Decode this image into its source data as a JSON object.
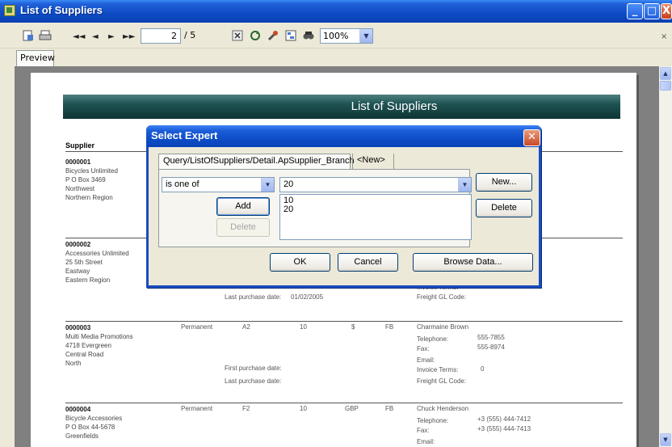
{
  "window": {
    "title": "List of Suppliers",
    "controls": {
      "minimize": "_",
      "maximize": "□",
      "close": "X"
    }
  },
  "toolbar": {
    "nav_first": "◄◄",
    "nav_prev": "◄",
    "nav_next": "►",
    "nav_last": "►►",
    "page_current": "2",
    "page_total": "/ 5",
    "zoom": "100%",
    "close_glyph": "×",
    "icons": [
      "export-icon",
      "print-icon",
      "stop-icon",
      "refresh-icon",
      "tools-icon",
      "group-tree-icon",
      "search-icon"
    ]
  },
  "tabs": {
    "preview": "Preview"
  },
  "report": {
    "banner_title": "List of Suppliers",
    "column_supplier": "Supplier",
    "records": [
      {
        "id": "0000001",
        "lines": [
          "Bicycles Unlimited",
          "P O Box 3469",
          "Northwest",
          "Northern Region"
        ]
      },
      {
        "id": "0000002",
        "lines": [
          "Accessories Unlimited",
          "25 5th Street",
          "Eastway",
          "Eastern Region"
        ],
        "last_purchase_label": "Last purchase date:",
        "last_purchase_value": "01/02/2005",
        "invoice_terms_label": "Invoice Terms:",
        "freight_label": "Freight GL Code:"
      },
      {
        "id": "0000003",
        "lines": [
          "Multi Media Promotions",
          "4718 Evergreen",
          "Central Road",
          "North"
        ],
        "type": "Permanent",
        "code": "A2",
        "days": "10",
        "currency": "$",
        "fb": "FB",
        "contact": "Charmaine Brown",
        "telephone_label": "Telephone:",
        "telephone": "555-7855",
        "fax_label": "Fax:",
        "fax": "555-8974",
        "email_label": "Email:",
        "first_purchase_label": "First purchase date:",
        "last_purchase_label": "Last purchase date:",
        "invoice_terms_label": "Invoice Terms:",
        "invoice_terms": "0",
        "freight_label": "Freight GL Code:"
      },
      {
        "id": "0000004",
        "lines": [
          "Bicycle Accessories",
          "P O Box 44-5678",
          "Greenfields"
        ],
        "type": "Permanent",
        "code": "F2",
        "days": "10",
        "currency": "GBP",
        "fb": "FB",
        "contact": "Chuck Henderson",
        "telephone_label": "Telephone:",
        "telephone": "+3 (555) 444-7412",
        "fax_label": "Fax:",
        "fax": "+3 (555) 444-7413",
        "email_label": "Email:"
      }
    ]
  },
  "dialog": {
    "title": "Select Expert",
    "tab_active": "Query/ListOfSuppliers/Detail.ApSupplier_Branch",
    "tab_new": "<New>",
    "operator": "is one of",
    "value": "20",
    "list_values": [
      "10",
      "20"
    ],
    "btn_add": "Add",
    "btn_delete_inner": "Delete",
    "btn_new": "New...",
    "btn_delete": "Delete",
    "btn_ok": "OK",
    "btn_cancel": "Cancel",
    "btn_browse": "Browse Data..."
  }
}
